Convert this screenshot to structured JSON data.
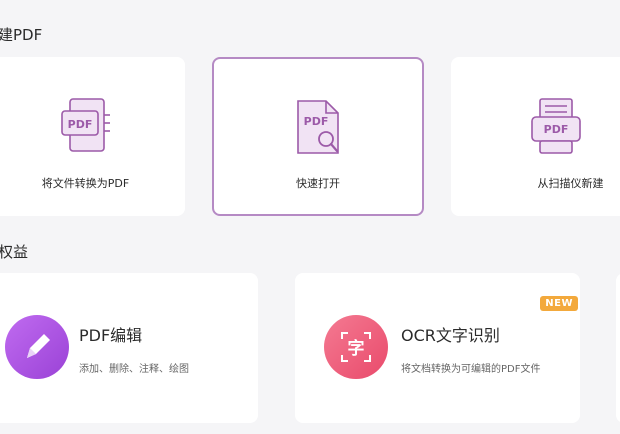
{
  "colors": {
    "accent": "#9c5aa8",
    "selected_border": "#b58ac4",
    "badge": "#f3a93c",
    "edit_gradient_start": "#c06bf0",
    "edit_gradient_end": "#9a42d6",
    "ocr_gradient_start": "#f47a92",
    "ocr_gradient_end": "#e94a6b"
  },
  "create_section": {
    "title": "建PDF",
    "cards": [
      {
        "label": "将文件转换为PDF",
        "icon": "convert-to-pdf-icon",
        "icon_text": "PDF",
        "selected": false
      },
      {
        "label": "快速打开",
        "icon": "quick-open-pdf-icon",
        "icon_text": "PDF",
        "selected": true
      },
      {
        "label": "从扫描仪新建",
        "icon": "scanner-pdf-icon",
        "icon_text": "PDF",
        "selected": false
      }
    ]
  },
  "benefits_section": {
    "title": "权益",
    "cards": [
      {
        "title": "PDF编辑",
        "desc": "添加、删除、注释、绘图",
        "icon": "pencil-edit-icon"
      },
      {
        "title": "OCR文字识别",
        "desc": "将文档转换为可编辑的PDF文件",
        "icon": "ocr-character-icon",
        "icon_char": "字",
        "badge": "NEW"
      }
    ]
  }
}
